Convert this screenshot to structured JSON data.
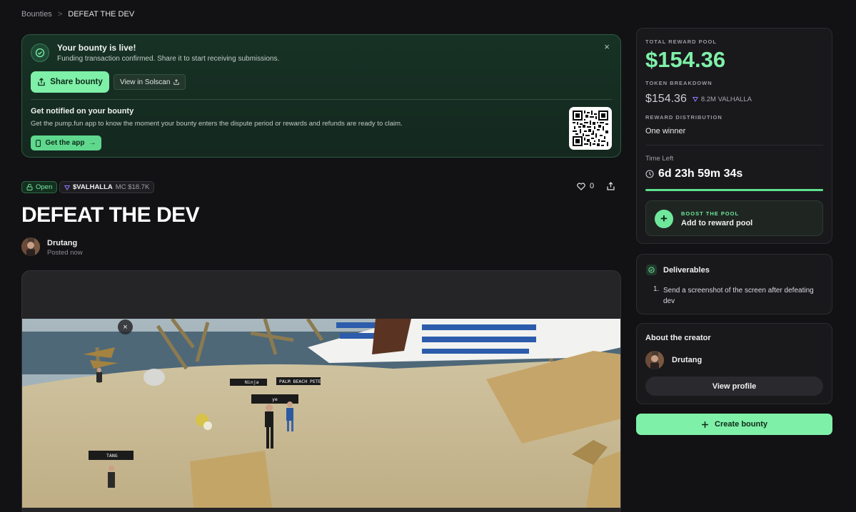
{
  "breadcrumb": {
    "root": "Bounties",
    "separator": ">",
    "current": "DEFEAT THE DEV"
  },
  "banner": {
    "title": "Your bounty is live!",
    "subtitle": "Funding transaction confirmed. Share it to start receiving submissions.",
    "close": "×",
    "share_label": "Share bounty",
    "solscan_label": "View in Solscan",
    "notify_title": "Get notified on your bounty",
    "notify_text": "Get the pump.fun app to know the moment your bounty enters the dispute period or rewards and refunds are ready to claim.",
    "app_label": "Get the app",
    "app_arrow": "→"
  },
  "tags": {
    "status": "Open",
    "token": "$VALHALLA",
    "mc": "MC $18.7K"
  },
  "likes": "0",
  "bounty": {
    "title": "DEFEAT THE DEV"
  },
  "author": {
    "name": "Drutang",
    "posted": "Posted now"
  },
  "media": {
    "close": "×",
    "nameplates": [
      "PALM BEACH PETE",
      "Ninja",
      "ye",
      "TANG"
    ]
  },
  "reward": {
    "pool_label": "TOTAL REWARD POOL",
    "amount": "$154.36",
    "breakdown_label": "TOKEN BREAKDOWN",
    "breakdown_usd": "$154.36",
    "breakdown_tokens": "8.2M VALHALLA",
    "distribution_label": "REWARD DISTRIBUTION",
    "distribution_value": "One winner",
    "time_label": "Time Left",
    "time_value": "6d 23h 59m 34s",
    "time_progress": 1.0,
    "boost_cap": "BOOST THE POOL",
    "boost_title": "Add to reward pool"
  },
  "deliverables": {
    "title": "Deliverables",
    "items": [
      {
        "num": "1.",
        "text": "Send a screenshot of the screen after defeating dev"
      }
    ]
  },
  "creator": {
    "heading": "About the creator",
    "name": "Drutang",
    "profile_label": "View profile"
  },
  "create_label": "Create bounty",
  "colors": {
    "accent": "#7ff0a8",
    "background": "#121214",
    "card": "#19191c",
    "banner": "#173225"
  },
  "icons": [
    "check-circle-icon",
    "close-icon",
    "share-icon",
    "external-link-icon",
    "phone-icon",
    "qr-code",
    "lock-open-icon",
    "token-triangle-icon",
    "heart-icon",
    "clock-icon",
    "plus-icon"
  ]
}
